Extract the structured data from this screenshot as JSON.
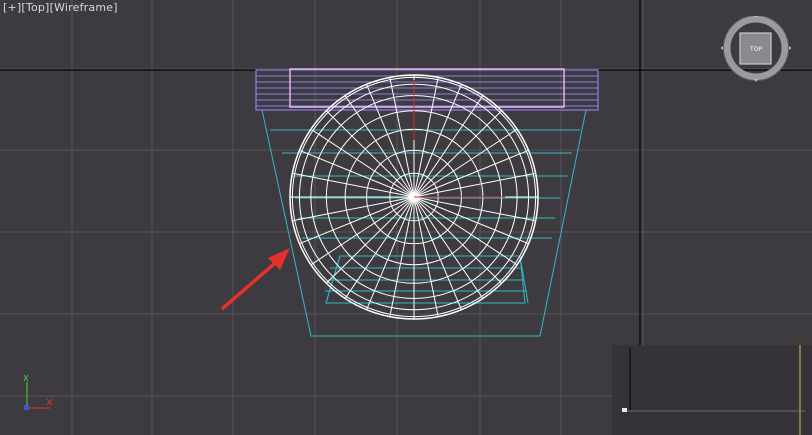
{
  "viewport": {
    "label_plus": "[+]",
    "label_view": "[Top]",
    "label_shading": "[Wireframe]"
  },
  "viewcube": {
    "face_label": "TOP"
  },
  "colors": {
    "background": "#3e3b40",
    "grid": "#57545a",
    "home_grid_line": "#000000",
    "sphere_wire": "#ffffff",
    "chair_wire": "#2fb8c9",
    "top_box_wire": "#8a7fe6",
    "plane_wire": "#e6b3f0",
    "annotation_arrow": "#e5312e",
    "axis_x": "#d0302a",
    "axis_y": "#3dbf3d",
    "axis_z": "#3a55e0"
  },
  "icons": {
    "viewcube": "viewcube-compass-icon",
    "axis_tripod": "axis-tripod-icon",
    "arrow": "annotation-arrow-icon"
  }
}
